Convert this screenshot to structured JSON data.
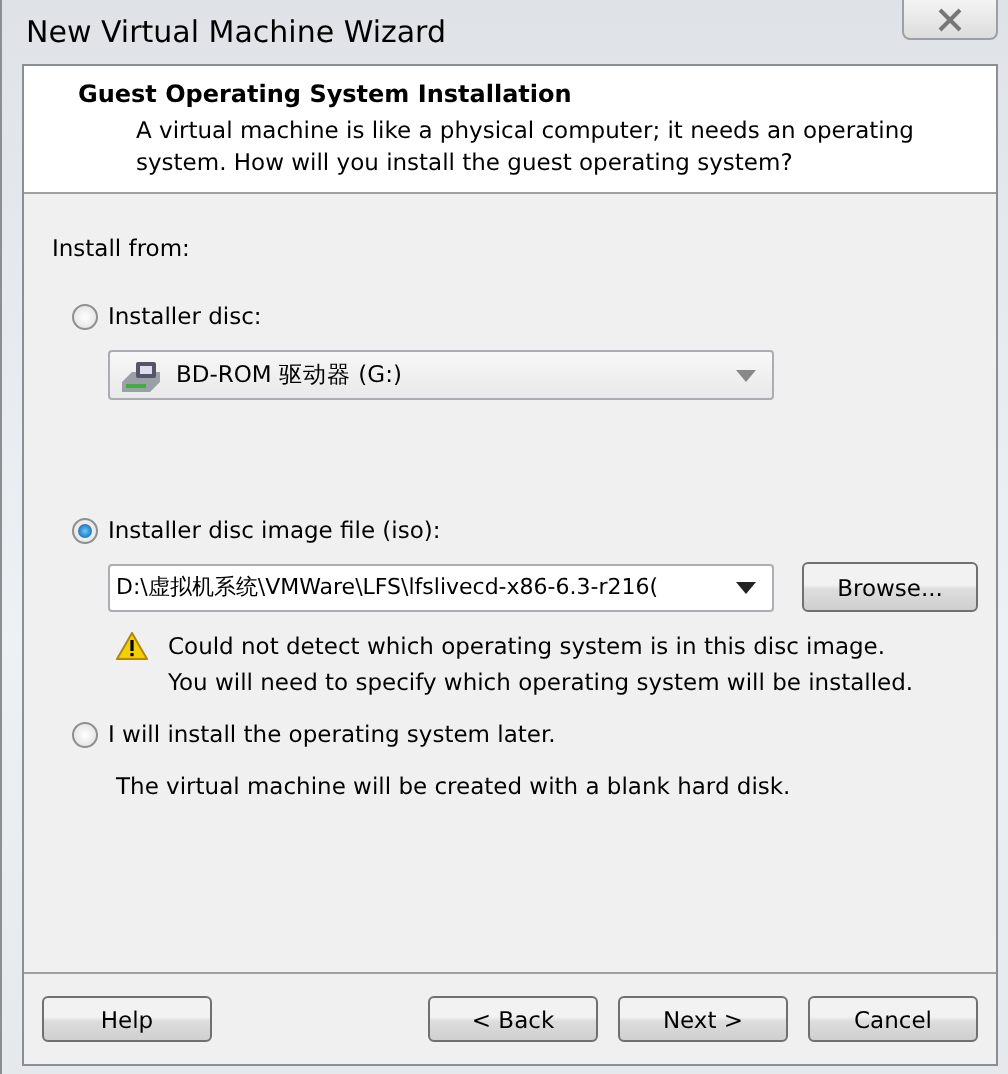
{
  "window": {
    "title": "New Virtual Machine Wizard"
  },
  "header": {
    "title": "Guest Operating System Installation",
    "description": "A virtual machine is like a physical computer; it needs an operating system. How will you install the guest operating system?"
  },
  "install_from_label": "Install from:",
  "options": [
    {
      "kind": "disc",
      "label": "Installer disc:",
      "selected": false,
      "dropdown": {
        "value": "BD-ROM 驱动器 (G:)"
      }
    },
    {
      "kind": "iso",
      "label": "Installer disc image file (iso):",
      "selected": true,
      "dropdown": {
        "value": "D:\\虚拟机系统\\VMWare\\LFS\\lfslivecd-x86-6.3-r216("
      },
      "button": "Browse...",
      "warning": [
        "Could not detect which operating system is in this disc image.",
        "You will need to specify which operating system will be installed."
      ]
    },
    {
      "kind": "later",
      "label": "I will install the operating system later.",
      "selected": false,
      "note": "The virtual machine will be created with a blank hard disk."
    }
  ],
  "buttons": [
    {
      "label": "Help",
      "kind": "help"
    },
    {
      "label": "< Back",
      "kind": "nav"
    },
    {
      "label": "Next >",
      "kind": "nav"
    },
    {
      "label": "Cancel",
      "kind": "nav"
    }
  ]
}
